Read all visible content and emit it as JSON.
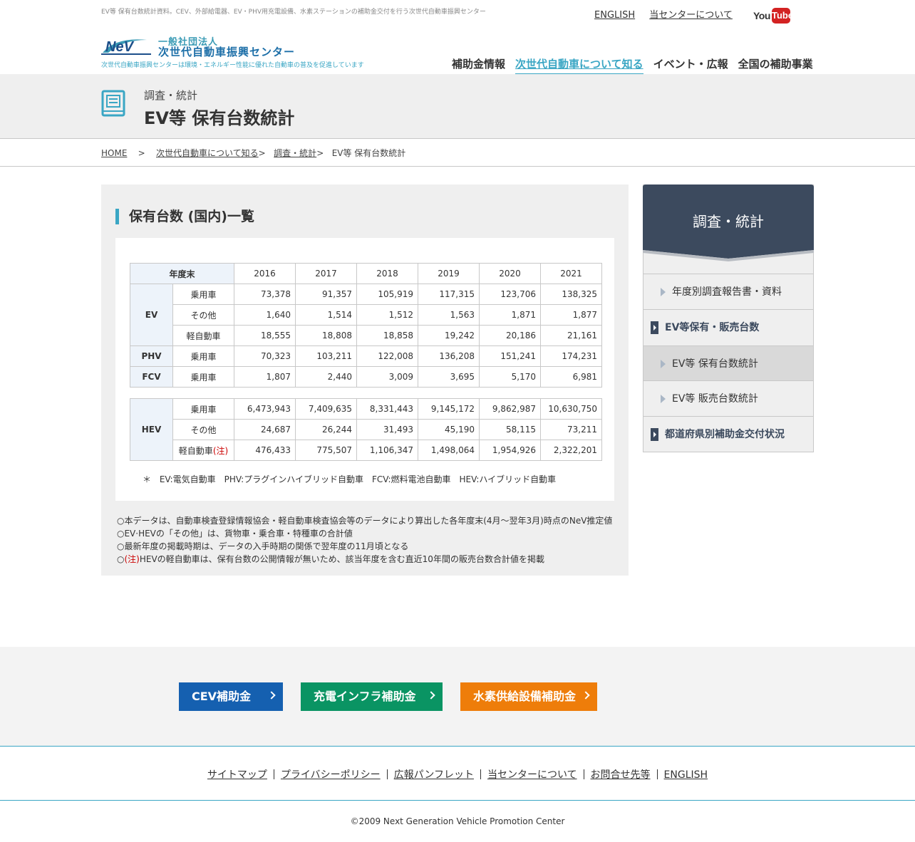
{
  "header": {
    "tagline": "EV等 保有台数統計資料。CEV、外部給電器、EV・PHV用充電設備、水素ステーションの補助金交付を行う次世代自動車振興センター",
    "links": [
      "ENGLISH",
      "当センターについて"
    ],
    "youtube": {
      "you": "You",
      "tube": "Tube"
    },
    "logo": {
      "mark": "NeV",
      "line1": "一般社団法人",
      "line2": "次世代自動車振興センター"
    },
    "subtag": "次世代自動車振興センターは環境・エネルギー性能に優れた自動車の普及を促進しています",
    "nav": [
      "補助金情報",
      "次世代自動車について知る",
      "イベント・広報",
      "全国の補助事業"
    ]
  },
  "title": {
    "category": "調査・統計",
    "heading": "EV等 保有台数統計"
  },
  "breadcrumb": {
    "home": "HOME",
    "sep": ">",
    "l1": "次世代自動車について知る",
    "l2": "調査・統計",
    "current": "EV等 保有台数統計"
  },
  "section": {
    "heading": "保有台数 (国内)一覧",
    "table1": {
      "corner": "年度末",
      "years": [
        "2016",
        "2017",
        "2018",
        "2019",
        "2020",
        "2021"
      ],
      "groups": [
        {
          "label": "EV",
          "rows": [
            {
              "type": "乗用車",
              "values": [
                "73,378",
                "91,357",
                "105,919",
                "117,315",
                "123,706",
                "138,325"
              ]
            },
            {
              "type": "その他",
              "values": [
                "1,640",
                "1,514",
                "1,512",
                "1,563",
                "1,871",
                "1,877"
              ]
            },
            {
              "type": "軽自動車",
              "values": [
                "18,555",
                "18,808",
                "18,858",
                "19,242",
                "20,186",
                "21,161"
              ]
            }
          ]
        },
        {
          "label": "PHV",
          "rows": [
            {
              "type": "乗用車",
              "values": [
                "70,323",
                "103,211",
                "122,008",
                "136,208",
                "151,241",
                "174,231"
              ]
            }
          ]
        },
        {
          "label": "FCV",
          "rows": [
            {
              "type": "乗用車",
              "values": [
                "1,807",
                "2,440",
                "3,009",
                "3,695",
                "5,170",
                "6,981"
              ]
            }
          ]
        }
      ]
    },
    "table2": {
      "label": "HEV",
      "rows": [
        {
          "type": "乗用車",
          "values": [
            "6,473,943",
            "7,409,635",
            "8,331,443",
            "9,145,172",
            "9,862,987",
            "10,630,750"
          ]
        },
        {
          "type": "その他",
          "values": [
            "24,687",
            "26,244",
            "31,493",
            "45,190",
            "58,115",
            "73,211"
          ]
        },
        {
          "type": "軽自動車",
          "note": "(注)",
          "values": [
            "476,433",
            "775,507",
            "1,106,347",
            "1,498,064",
            "1,954,926",
            "2,322,201"
          ]
        }
      ]
    },
    "legend": "＊ EV:電気自動車　PHV:プラグインハイブリッド自動車　FCV:燃料電池自動車　HEV:ハイブリッド自動車",
    "notes": [
      "○本データは、自動車検査登録情報協会・軽自動車検査協会等のデータにより算出した各年度末(4月～翌年3月)時点のNeV推定値",
      "○EV·HEVの「その他」は、貨物車・乗合車・特種車の合計値",
      "○最新年度の掲載時期は、データの入手時期の関係で翌年度の11月頃となる"
    ],
    "note4": {
      "prefix": "○",
      "red": "(注)",
      "text": "HEVの軽自動車は、保有台数の公開情報が無いため、該当年度を含む直近10年間の販売台数合計値を掲載"
    }
  },
  "sidebar": {
    "title": "調査・統計",
    "items": [
      "年度別調査報告書・資料",
      "EV等保有・販売台数",
      "EV等 保有台数統計",
      "EV等 販売台数統計",
      "都道府県別補助金交付状況"
    ]
  },
  "footer": {
    "buttons": [
      {
        "label": "CEV補助金",
        "color": "#1560b0"
      },
      {
        "label": "充電インフラ補助金",
        "color": "#0a9463"
      },
      {
        "label": "水素供給設備補助金",
        "color": "#ee7d0a"
      }
    ],
    "links": [
      "サイトマップ",
      "プライバシーポリシー",
      "広報パンフレット",
      "当センターについて",
      "お問合せ先等",
      "ENGLISH"
    ],
    "copyright": "©2009 Next Generation Vehicle Promotion Center"
  },
  "colors": {
    "accent": "#3aa6c4",
    "sidebar_header": "#3c4a5e"
  },
  "icons": [
    "book-icon",
    "youtube-logo",
    "nev-logo",
    "arrow-right-icon",
    "chevron-right-icon"
  ]
}
